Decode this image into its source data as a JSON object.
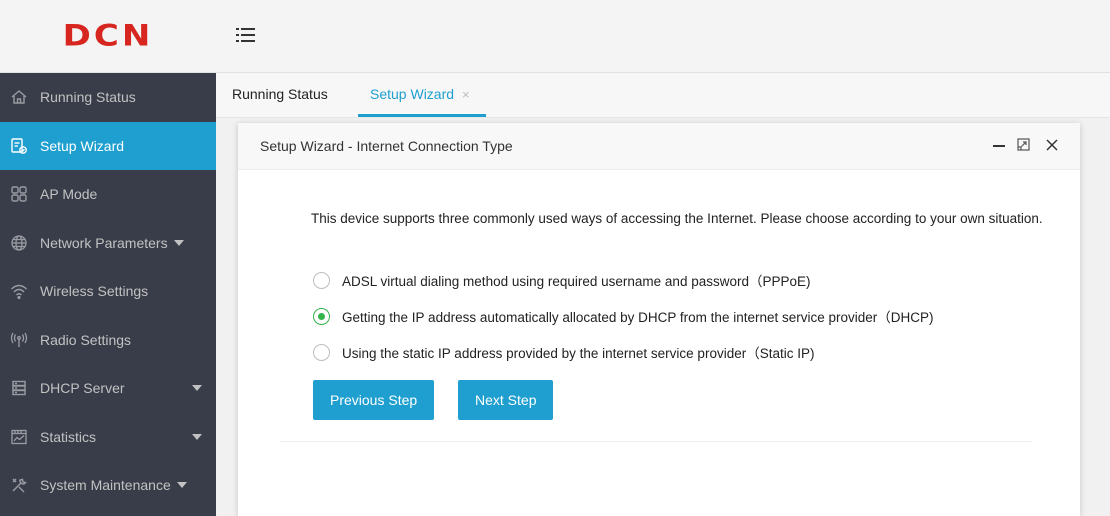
{
  "brand": {
    "logo_text": "DCN",
    "logo_color": "#d6261f"
  },
  "header": {
    "menu_icon": "menu-icon"
  },
  "sidebar": {
    "items": [
      {
        "label": "Running Status",
        "icon": "home-icon",
        "active": false,
        "caret": false
      },
      {
        "label": "Setup Wizard",
        "icon": "wizard-icon",
        "active": true,
        "caret": false
      },
      {
        "label": "AP Mode",
        "icon": "grid-icon",
        "active": false,
        "caret": false
      },
      {
        "label": "Network Parameters",
        "icon": "globe-icon",
        "active": false,
        "caret": true
      },
      {
        "label": "Wireless Settings",
        "icon": "wifi-icon",
        "active": false,
        "caret": false
      },
      {
        "label": "Radio Settings",
        "icon": "radio-icon",
        "active": false,
        "caret": false
      },
      {
        "label": "DHCP Server",
        "icon": "server-icon",
        "active": false,
        "caret": true
      },
      {
        "label": "Statistics",
        "icon": "chart-icon",
        "active": false,
        "caret": true
      },
      {
        "label": "System Maintenance",
        "icon": "tools-icon",
        "active": false,
        "caret": true
      }
    ]
  },
  "tabs": [
    {
      "label": "Running Status",
      "active": false
    },
    {
      "label": "Setup Wizard",
      "active": true,
      "close": "×"
    }
  ],
  "modal": {
    "title": "Setup Wizard - Internet Connection Type",
    "intro": "This device supports three commonly used ways of accessing the Internet. Please choose according to your own situation.",
    "options": [
      {
        "label": "ADSL virtual dialing method using required username and password（PPPoE)",
        "checked": false
      },
      {
        "label": "Getting the IP address automatically allocated by DHCP from the internet service provider（DHCP)",
        "checked": true
      },
      {
        "label": "Using the static IP address provided by the internet service provider（Static IP)",
        "checked": false
      }
    ],
    "buttons": {
      "previous": "Previous Step",
      "next": "Next Step"
    }
  },
  "colors": {
    "sidebar_bg": "#393d49",
    "accent": "#1e9fd0",
    "radio_checked": "#33b34a"
  }
}
